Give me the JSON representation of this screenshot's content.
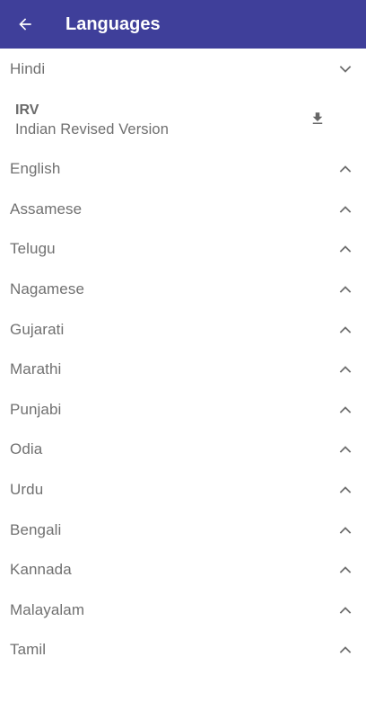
{
  "app_bar": {
    "title": "Languages",
    "background": "#3f3f9a",
    "back_icon": "arrow-left-icon"
  },
  "expanded_language": {
    "name": "Hindi",
    "chevron": "chevron-down-icon",
    "versions": [
      {
        "code": "IRV",
        "name": "Indian Revised Version",
        "action_icon": "download-icon"
      }
    ]
  },
  "languages": [
    {
      "name": "English",
      "chevron": "chevron-up-icon"
    },
    {
      "name": "Assamese",
      "chevron": "chevron-up-icon"
    },
    {
      "name": "Telugu",
      "chevron": "chevron-up-icon"
    },
    {
      "name": "Nagamese",
      "chevron": "chevron-up-icon"
    },
    {
      "name": "Gujarati",
      "chevron": "chevron-up-icon"
    },
    {
      "name": "Marathi",
      "chevron": "chevron-up-icon"
    },
    {
      "name": "Punjabi",
      "chevron": "chevron-up-icon"
    },
    {
      "name": "Odia",
      "chevron": "chevron-up-icon"
    },
    {
      "name": "Urdu",
      "chevron": "chevron-up-icon"
    },
    {
      "name": "Bengali",
      "chevron": "chevron-up-icon"
    },
    {
      "name": "Kannada",
      "chevron": "chevron-up-icon"
    },
    {
      "name": "Malayalam",
      "chevron": "chevron-up-icon"
    },
    {
      "name": "Tamil",
      "chevron": "chevron-up-icon"
    }
  ]
}
